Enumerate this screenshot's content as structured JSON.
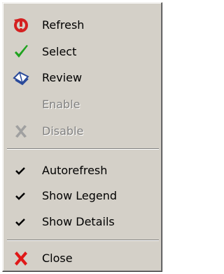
{
  "menu": {
    "items": [
      {
        "label": "Refresh",
        "icon": "refresh-icon",
        "enabled": true
      },
      {
        "label": "Select",
        "icon": "green-check-icon",
        "enabled": true
      },
      {
        "label": "Review",
        "icon": "book-icon",
        "enabled": true
      },
      {
        "label": "Enable",
        "icon": "",
        "enabled": false
      },
      {
        "label": "Disable",
        "icon": "gray-x-icon",
        "enabled": false
      }
    ],
    "toggles": [
      {
        "label": "Autorefresh",
        "checked": true
      },
      {
        "label": "Show Legend",
        "checked": true
      },
      {
        "label": "Show Details",
        "checked": true
      }
    ],
    "close": {
      "label": "Close",
      "icon": "red-x-icon",
      "enabled": true
    }
  },
  "colors": {
    "menu_bg": "#d4d0c8",
    "refresh_red": "#d42020",
    "select_green": "#1fa31f",
    "review_blue": "#2a4a9a",
    "close_red": "#e01818",
    "disabled_text": "#808080"
  }
}
